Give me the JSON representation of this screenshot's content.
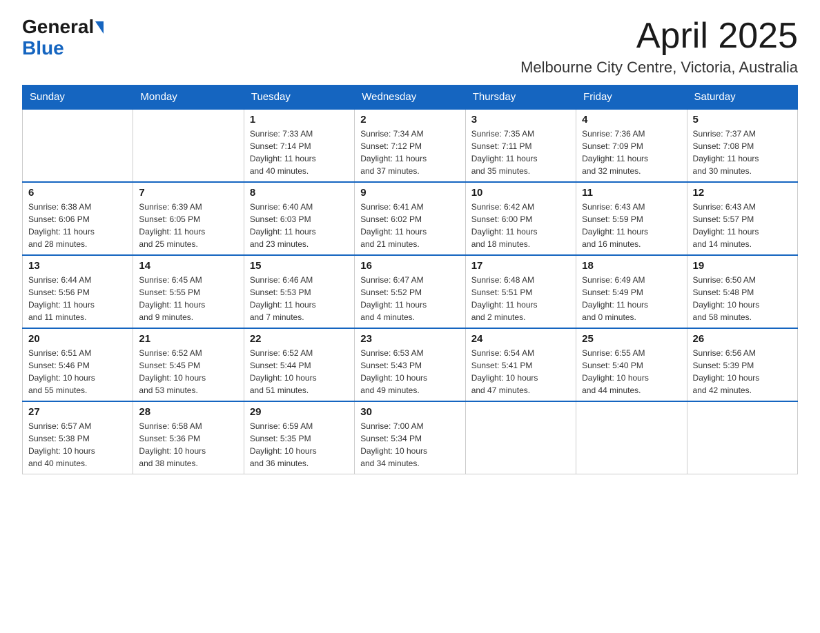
{
  "header": {
    "logo_general": "General",
    "logo_blue": "Blue",
    "month_title": "April 2025",
    "location": "Melbourne City Centre, Victoria, Australia"
  },
  "days_of_week": [
    "Sunday",
    "Monday",
    "Tuesday",
    "Wednesday",
    "Thursday",
    "Friday",
    "Saturday"
  ],
  "weeks": [
    [
      {
        "day": "",
        "info": ""
      },
      {
        "day": "",
        "info": ""
      },
      {
        "day": "1",
        "info": "Sunrise: 7:33 AM\nSunset: 7:14 PM\nDaylight: 11 hours\nand 40 minutes."
      },
      {
        "day": "2",
        "info": "Sunrise: 7:34 AM\nSunset: 7:12 PM\nDaylight: 11 hours\nand 37 minutes."
      },
      {
        "day": "3",
        "info": "Sunrise: 7:35 AM\nSunset: 7:11 PM\nDaylight: 11 hours\nand 35 minutes."
      },
      {
        "day": "4",
        "info": "Sunrise: 7:36 AM\nSunset: 7:09 PM\nDaylight: 11 hours\nand 32 minutes."
      },
      {
        "day": "5",
        "info": "Sunrise: 7:37 AM\nSunset: 7:08 PM\nDaylight: 11 hours\nand 30 minutes."
      }
    ],
    [
      {
        "day": "6",
        "info": "Sunrise: 6:38 AM\nSunset: 6:06 PM\nDaylight: 11 hours\nand 28 minutes."
      },
      {
        "day": "7",
        "info": "Sunrise: 6:39 AM\nSunset: 6:05 PM\nDaylight: 11 hours\nand 25 minutes."
      },
      {
        "day": "8",
        "info": "Sunrise: 6:40 AM\nSunset: 6:03 PM\nDaylight: 11 hours\nand 23 minutes."
      },
      {
        "day": "9",
        "info": "Sunrise: 6:41 AM\nSunset: 6:02 PM\nDaylight: 11 hours\nand 21 minutes."
      },
      {
        "day": "10",
        "info": "Sunrise: 6:42 AM\nSunset: 6:00 PM\nDaylight: 11 hours\nand 18 minutes."
      },
      {
        "day": "11",
        "info": "Sunrise: 6:43 AM\nSunset: 5:59 PM\nDaylight: 11 hours\nand 16 minutes."
      },
      {
        "day": "12",
        "info": "Sunrise: 6:43 AM\nSunset: 5:57 PM\nDaylight: 11 hours\nand 14 minutes."
      }
    ],
    [
      {
        "day": "13",
        "info": "Sunrise: 6:44 AM\nSunset: 5:56 PM\nDaylight: 11 hours\nand 11 minutes."
      },
      {
        "day": "14",
        "info": "Sunrise: 6:45 AM\nSunset: 5:55 PM\nDaylight: 11 hours\nand 9 minutes."
      },
      {
        "day": "15",
        "info": "Sunrise: 6:46 AM\nSunset: 5:53 PM\nDaylight: 11 hours\nand 7 minutes."
      },
      {
        "day": "16",
        "info": "Sunrise: 6:47 AM\nSunset: 5:52 PM\nDaylight: 11 hours\nand 4 minutes."
      },
      {
        "day": "17",
        "info": "Sunrise: 6:48 AM\nSunset: 5:51 PM\nDaylight: 11 hours\nand 2 minutes."
      },
      {
        "day": "18",
        "info": "Sunrise: 6:49 AM\nSunset: 5:49 PM\nDaylight: 11 hours\nand 0 minutes."
      },
      {
        "day": "19",
        "info": "Sunrise: 6:50 AM\nSunset: 5:48 PM\nDaylight: 10 hours\nand 58 minutes."
      }
    ],
    [
      {
        "day": "20",
        "info": "Sunrise: 6:51 AM\nSunset: 5:46 PM\nDaylight: 10 hours\nand 55 minutes."
      },
      {
        "day": "21",
        "info": "Sunrise: 6:52 AM\nSunset: 5:45 PM\nDaylight: 10 hours\nand 53 minutes."
      },
      {
        "day": "22",
        "info": "Sunrise: 6:52 AM\nSunset: 5:44 PM\nDaylight: 10 hours\nand 51 minutes."
      },
      {
        "day": "23",
        "info": "Sunrise: 6:53 AM\nSunset: 5:43 PM\nDaylight: 10 hours\nand 49 minutes."
      },
      {
        "day": "24",
        "info": "Sunrise: 6:54 AM\nSunset: 5:41 PM\nDaylight: 10 hours\nand 47 minutes."
      },
      {
        "day": "25",
        "info": "Sunrise: 6:55 AM\nSunset: 5:40 PM\nDaylight: 10 hours\nand 44 minutes."
      },
      {
        "day": "26",
        "info": "Sunrise: 6:56 AM\nSunset: 5:39 PM\nDaylight: 10 hours\nand 42 minutes."
      }
    ],
    [
      {
        "day": "27",
        "info": "Sunrise: 6:57 AM\nSunset: 5:38 PM\nDaylight: 10 hours\nand 40 minutes."
      },
      {
        "day": "28",
        "info": "Sunrise: 6:58 AM\nSunset: 5:36 PM\nDaylight: 10 hours\nand 38 minutes."
      },
      {
        "day": "29",
        "info": "Sunrise: 6:59 AM\nSunset: 5:35 PM\nDaylight: 10 hours\nand 36 minutes."
      },
      {
        "day": "30",
        "info": "Sunrise: 7:00 AM\nSunset: 5:34 PM\nDaylight: 10 hours\nand 34 minutes."
      },
      {
        "day": "",
        "info": ""
      },
      {
        "day": "",
        "info": ""
      },
      {
        "day": "",
        "info": ""
      }
    ]
  ]
}
